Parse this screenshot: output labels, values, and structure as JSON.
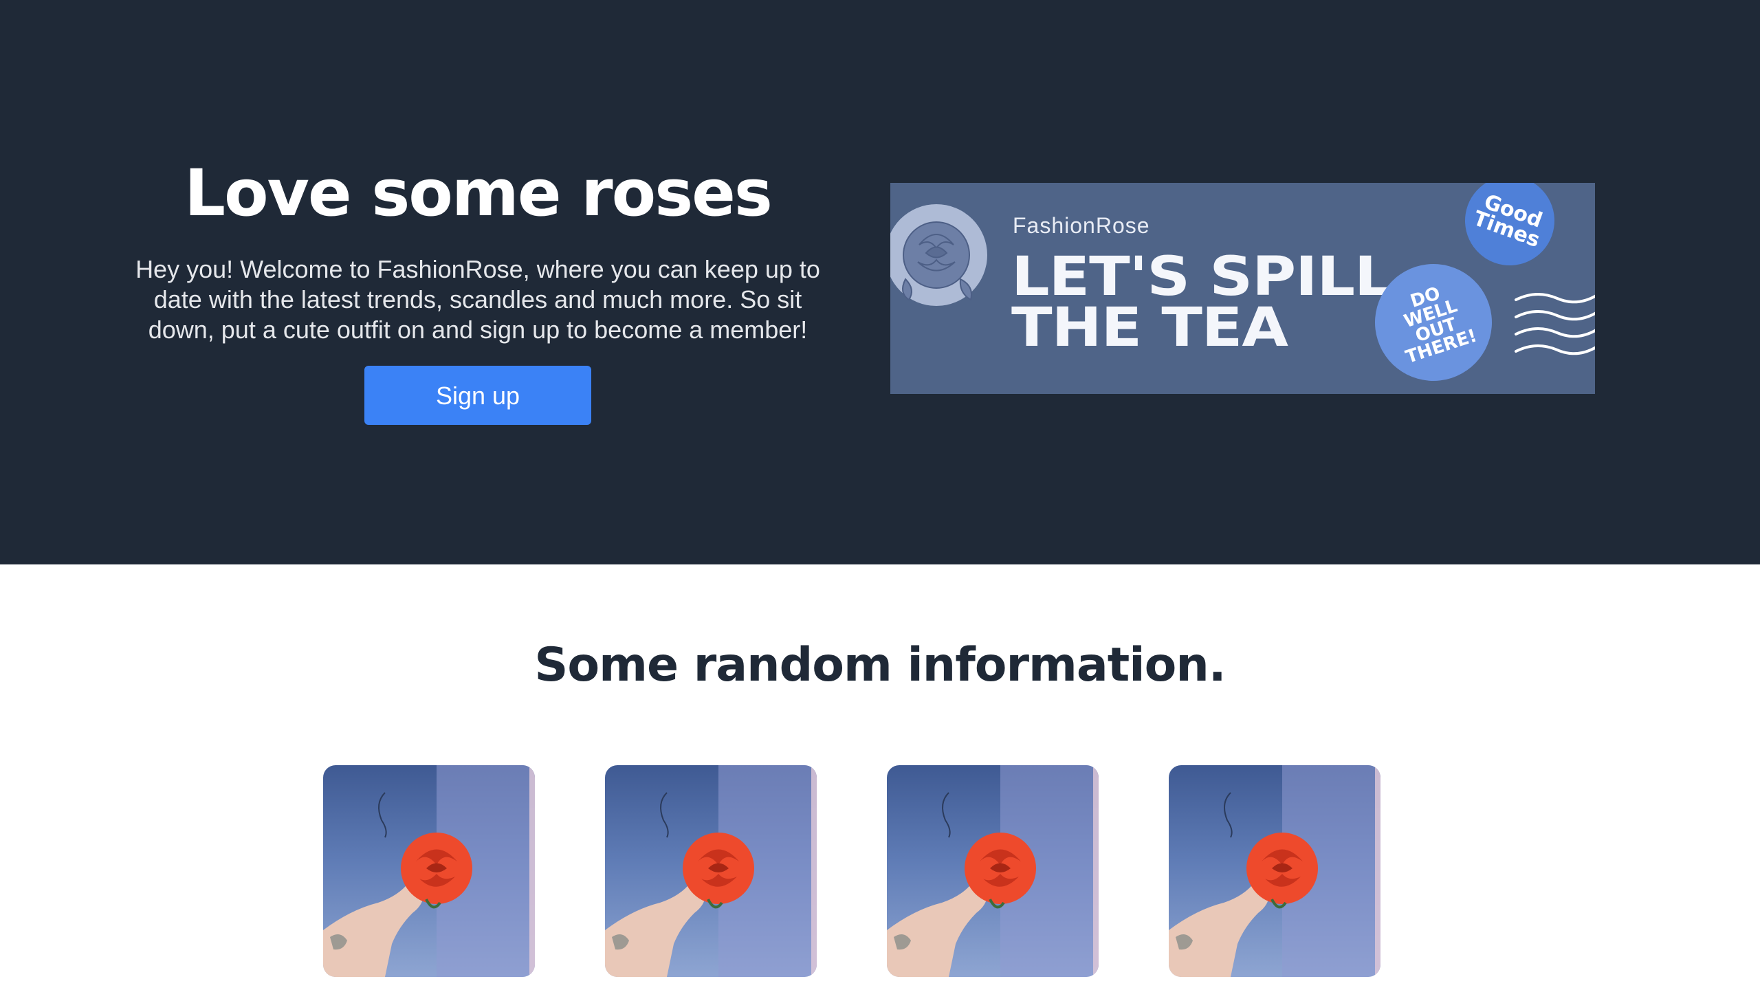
{
  "hero": {
    "title": "Love some roses",
    "text": "Hey you! Welcome to FashionRose, where you can keep up to date with the latest trends, scandles and much more. So sit down, put a cute outfit on and sign up to become a member!",
    "signup_label": "Sign up"
  },
  "banner": {
    "brand": "FashionRose",
    "headline_line1": "LET'S SPILL",
    "headline_line2": "THE TEA",
    "badge_good_line1": "Good",
    "badge_good_line2": "Times",
    "badge_do_line1": "DO",
    "badge_do_line2": "WELL",
    "badge_do_line3": "OUT",
    "badge_do_line4": "THERE!"
  },
  "info": {
    "title": "Some random information."
  },
  "colors": {
    "hero_bg": "#1f2937",
    "accent": "#3b82f6",
    "banner_bg": "#4f6488",
    "rose": "#ee4a2c"
  }
}
